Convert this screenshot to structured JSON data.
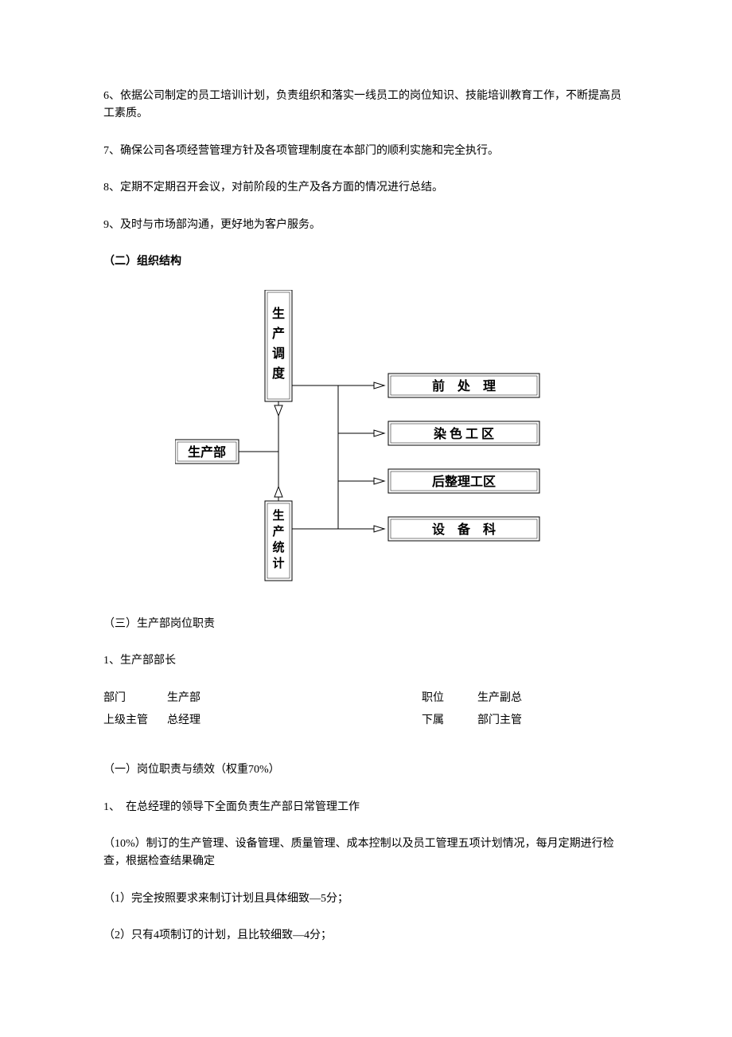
{
  "paras": {
    "p6": "6、依据公司制定的员工培训计划，负责组织和落实一线员工的岗位知识、技能培训教育工作，不断提高员工素质。",
    "p7": "7、确保公司各项经营管理方针及各项管理制度在本部门的顺利实施和完全执行。",
    "p8": "8、定期不定期召开会议，对前阶段的生产及各方面的情况进行总结。",
    "p9": "9、及时与市场部沟通，更好地为客户服务。"
  },
  "sections": {
    "org_structure": "（二）组织结构",
    "dept_duties": "（三）生产部岗位职责",
    "role_head": "1、生产部部长",
    "duties_weight": "（一）岗位职责与绩效（权重70%）",
    "duty1_title": "1、　在总经理的领导下全面负责生产部日常管理工作",
    "duty1_desc": "（10%）制订的生产管理、设备管理、质量管理、成本控制以及员工管理五项计划情况，每月定期进行检查，根据检查结果确定",
    "duty1_item1": "（1）完全按照要求来制订计划且具体细致—5分；",
    "duty1_item2": "（2）只有4项制订的计划，且比较细致—4分；"
  },
  "org": {
    "root": "生产部",
    "upper": "生产调度",
    "lower": "生产统计",
    "right": [
      "前　处　理",
      "染 色 工 区",
      "后整理工区",
      "设　备　科"
    ]
  },
  "info": {
    "dept_label": "部门",
    "dept_value": "生产部",
    "position_label": "职位",
    "position_value": "生产副总",
    "super_label": "上级主管",
    "super_value": "总经理",
    "sub_label": "下属",
    "sub_value": "部门主管"
  }
}
